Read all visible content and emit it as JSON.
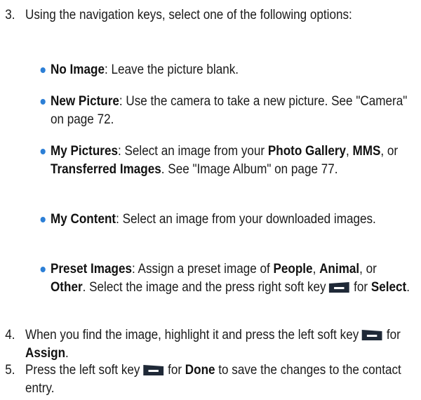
{
  "step3": {
    "number": "3.",
    "text": "Using the navigation keys, select one of the following options:"
  },
  "bullets": [
    {
      "term": "No Image",
      "sep": ": ",
      "desc": "Leave the picture blank."
    },
    {
      "term": "New Picture",
      "sep": ": ",
      "desc": "Use the camera to take a new picture. See \"Camera\" on page 72."
    },
    {
      "term": "My Pictures",
      "sep": ": ",
      "d1": "Select an image from your ",
      "b1": "Photo Gallery",
      "d2": ", ",
      "b2": "MMS",
      "d3": ", or ",
      "b3": "Transferred Images",
      "d4": ". See \"Image Album\" on page 77."
    },
    {
      "term": "My Content",
      "sep": ": ",
      "desc": "Select an image from your downloaded images."
    },
    {
      "term": "Preset Images",
      "sep": ": ",
      "d1": "Assign a preset image of ",
      "b1": "People",
      "d2": ", ",
      "b2": "Animal",
      "d3": ", or ",
      "b3": "Other",
      "d4": ". Select the image and the press right soft key",
      "d5": "for ",
      "b4": "Select",
      "d6": "."
    }
  ],
  "step4": {
    "number": "4.",
    "text_before": "When you find the image, highlight it and press the left soft key",
    "text_for": "for ",
    "bold": "Assign",
    "end": "."
  },
  "step5": {
    "number": "5.",
    "text_before": "Press the left soft key",
    "text_for": "for ",
    "bold": "Done",
    "text_after": " to save the changes to the contact entry."
  },
  "icons": {
    "right_softkey": "right-softkey-icon",
    "left_softkey": "left-softkey-icon"
  }
}
